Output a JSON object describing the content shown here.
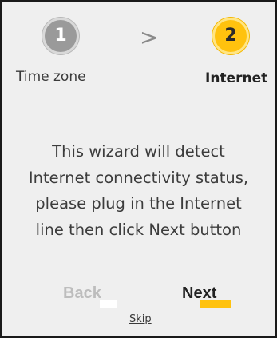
{
  "steps": [
    {
      "number": "1",
      "label": "Time zone",
      "state": "completed"
    },
    {
      "number": "2",
      "label": "Internet",
      "state": "current"
    }
  ],
  "separator": ">",
  "message_lines": [
    "This wizard will detect",
    "Internet connectivity status,",
    "please plug in the Internet",
    "line then click Next button"
  ],
  "buttons": {
    "back_label": "Back",
    "next_label": "Next",
    "skip_label": "Skip"
  },
  "colors": {
    "accent": "#ffc20e",
    "completed_step": "#9a9a9a",
    "disabled_text": "#bdbdbd",
    "panel_bg": "#efefef"
  }
}
